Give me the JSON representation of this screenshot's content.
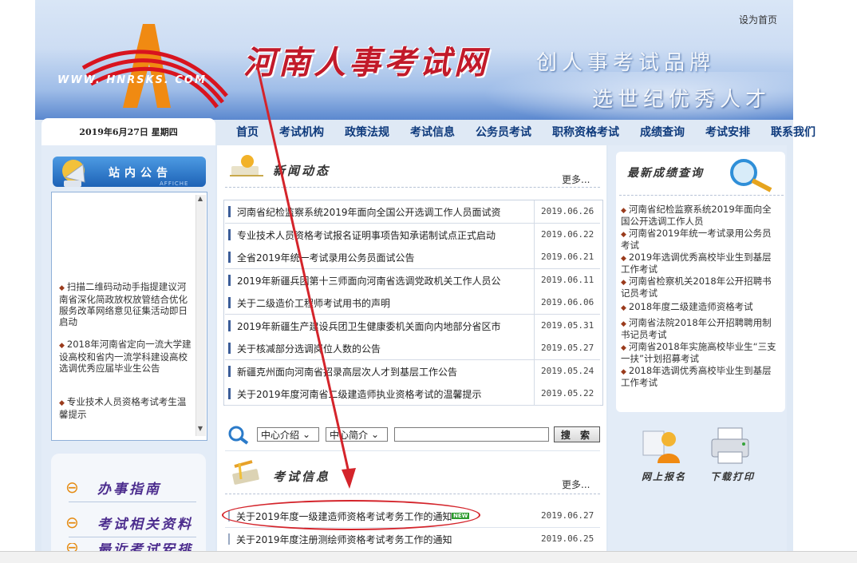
{
  "header": {
    "set_home": "设为首页",
    "logo_url": "WWW. HNRSKS. COM",
    "site_title": "河南人事考试网",
    "slogan_1": "创人事考试品牌",
    "slogan_2": "选世纪优秀人才"
  },
  "date_text": "2019年6月27日  星期四",
  "nav": [
    "首页",
    "考试机构",
    "政策法规",
    "考试信息",
    "公务员考试",
    "职称资格考试",
    "成绩查询",
    "考试安排",
    "联系我们"
  ],
  "notice": {
    "title": "站内公告",
    "subtitle": "AFFICHE",
    "items": [
      "扫描二维码动动手指提建议河南省深化简政放权放管结合优化服务改革网络意见征集活动即日启动",
      "2018年河南省定向一流大学建设高校和省内一流学科建设高校选调优秀应届毕业生公告",
      "专业技术人员资格考试考生温馨提示"
    ]
  },
  "guides": [
    "办事指南",
    "考试相关资料",
    "最近考试安排"
  ],
  "news": {
    "title": "新闻动态",
    "more": "更多...",
    "items": [
      {
        "title": "河南省纪检监察系统2019年面向全国公开选调工作人员面试资",
        "date": "2019.06.26"
      },
      {
        "title": "专业技术人员资格考试报名证明事项告知承诺制试点正式启动",
        "date": "2019.06.22"
      },
      {
        "title": "全省2019年统一考试录用公务员面试公告",
        "date": "2019.06.21"
      },
      {
        "title": "2019年新疆兵团第十三师面向河南省选调党政机关工作人员公",
        "date": "2019.06.11"
      },
      {
        "title": "关于二级造价工程师考试用书的声明",
        "date": "2019.06.06"
      },
      {
        "title": "2019年新疆生产建设兵团卫生健康委机关面向内地部分省区市",
        "date": "2019.05.31"
      },
      {
        "title": "关于核减部分选调岗位人数的公告",
        "date": "2019.05.27"
      },
      {
        "title": "新疆克州面向河南省招录高层次人才到基层工作公告",
        "date": "2019.05.24"
      },
      {
        "title": "关于2019年度河南省二级建造师执业资格考试的温馨提示",
        "date": "2019.05.22"
      }
    ]
  },
  "search": {
    "select_1": "中心介绍",
    "select_2": "中心简介",
    "button": "搜 索"
  },
  "exam": {
    "title": "考试信息",
    "more": "更多...",
    "new_badge": "NEW",
    "items": [
      {
        "title": "关于2019年度一级建造师资格考试考务工作的通知",
        "date": "2019.06.27"
      },
      {
        "title": "关于2019年度注册测绘师资格考试考务工作的通知",
        "date": "2019.06.25"
      }
    ]
  },
  "scores": {
    "title": "最新成绩查询",
    "items": [
      "河南省纪检监察系统2019年面向全国公开选调工作人员",
      "河南省2019年统一考试录用公务员考试",
      "2019年选调优秀高校毕业生到基层工作考试",
      "河南省检察机关2018年公开招聘书记员考试",
      "2018年度二级建造师资格考试",
      "河南省法院2018年公开招聘聘用制书记员考试",
      "河南省2018年实施高校毕业生“三支一扶”计划招募考试",
      "2018年选调优秀高校毕业生到基层工作考试"
    ]
  },
  "actions": {
    "register": "网上报名",
    "print": "下载打印"
  },
  "colors": {
    "nav_text": "#0e3a7c",
    "title_red": "#c21a2a",
    "annotation_red": "#d4242b",
    "notice_blue": "#1d62b6"
  }
}
